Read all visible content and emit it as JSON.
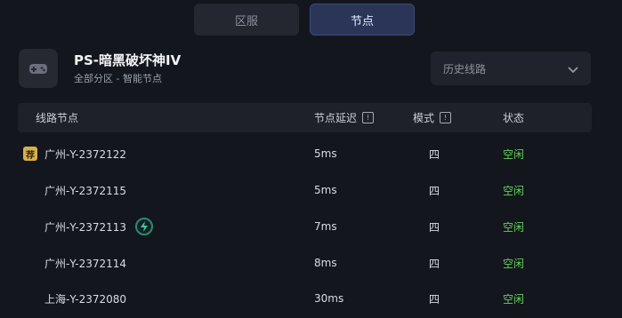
{
  "tabs": [
    {
      "label": "区服",
      "active": false
    },
    {
      "label": "节点",
      "active": true
    }
  ],
  "game": {
    "icon": "gamepad-icon",
    "title": "PS-暗黑破坏神IV",
    "subtitle": "全部分区 - 智能节点"
  },
  "history": {
    "label": "历史线路",
    "icon": "chevron-down-icon"
  },
  "table": {
    "headers": {
      "node": "线路节点",
      "latency": "节点延迟",
      "mode": "模式",
      "status": "状态"
    },
    "rows": [
      {
        "badge": "荐",
        "name": "广州-Y-2372122",
        "latency": "5ms",
        "mode": "四",
        "status": "空闲",
        "boost": false
      },
      {
        "badge": "",
        "name": "广州-Y-2372115",
        "latency": "5ms",
        "mode": "四",
        "status": "空闲",
        "boost": false
      },
      {
        "badge": "",
        "name": "广州-Y-2372113",
        "latency": "7ms",
        "mode": "四",
        "status": "空闲",
        "boost": true
      },
      {
        "badge": "",
        "name": "广州-Y-2372114",
        "latency": "8ms",
        "mode": "四",
        "status": "空闲",
        "boost": false
      },
      {
        "badge": "",
        "name": "上海-Y-2372080",
        "latency": "30ms",
        "mode": "四",
        "status": "空闲",
        "boost": false
      }
    ]
  },
  "colors": {
    "background": "#14161d",
    "active_tab": "#2b3558",
    "status_idle": "#5fd35a",
    "badge": "#d8b04a"
  }
}
